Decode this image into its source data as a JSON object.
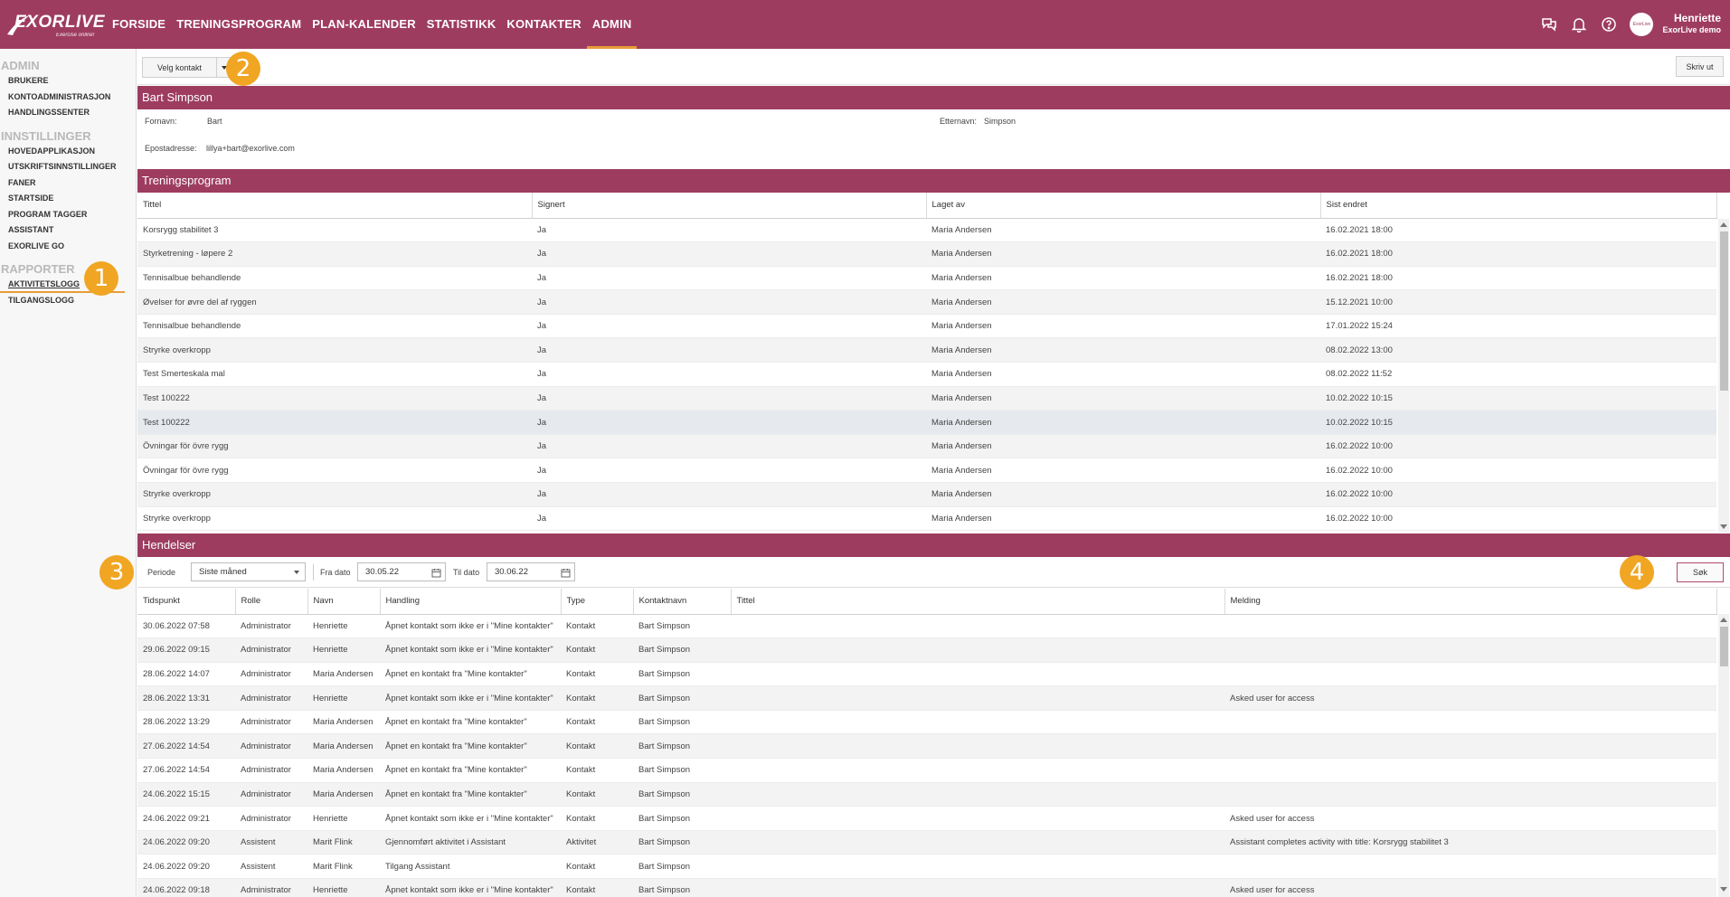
{
  "brand": {
    "name": "EXORLIVE",
    "tagline": "Exercise online!"
  },
  "nav": {
    "items": [
      "FORSIDE",
      "TRENINGSPROGRAM",
      "PLAN-KALENDER",
      "STATISTIKK",
      "KONTAKTER",
      "ADMIN"
    ],
    "active": "ADMIN"
  },
  "user": {
    "name": "Henriette",
    "org": "ExorLive demo",
    "avatar_text": "ExorLive"
  },
  "sidebar": {
    "admin_head": "ADMIN",
    "admin_items": [
      "BRUKERE",
      "KONTOADMINISTRASJON",
      "HANDLINGSSENTER"
    ],
    "settings_head": "INNSTILLINGER",
    "settings_items": [
      "HOVEDAPPLIKASJON",
      "UTSKRIFTSINNSTILLINGER",
      "FANER",
      "STARTSIDE",
      "PROGRAM TAGGER",
      "ASSISTANT",
      "EXORLIVE GO"
    ],
    "reports_head": "RAPPORTER",
    "reports_items": [
      "AKTIVITETSLOGG",
      "TILGANGSLOGG"
    ]
  },
  "badges": [
    "1",
    "2",
    "3",
    "4"
  ],
  "toolbar": {
    "select_contact": "Velg kontakt",
    "print": "Skriv ut"
  },
  "contact": {
    "header": "Bart Simpson",
    "firstname_label": "Fornavn:",
    "firstname": "Bart",
    "lastname_label": "Etternavn:",
    "lastname": "Simpson",
    "email_label": "Epostadresse:",
    "email": "lillya+bart@exorlive.com"
  },
  "programs": {
    "header": "Treningsprogram",
    "columns": [
      "Tittel",
      "Signert",
      "Laget av",
      "Sist endret"
    ],
    "rows": [
      [
        "Korsrygg stabilitet 3",
        "Ja",
        "Maria Andersen",
        "16.02.2021 18:00"
      ],
      [
        "Styrketrening - løpere 2",
        "Ja",
        "Maria Andersen",
        "16.02.2021 18:00"
      ],
      [
        "Tennisalbue behandlende",
        "Ja",
        "Maria Andersen",
        "16.02.2021 18:00"
      ],
      [
        "Øvelser for øvre del af ryggen",
        "Ja",
        "Maria Andersen",
        "15.12.2021 10:00"
      ],
      [
        "Tennisalbue behandlende",
        "Ja",
        "Maria Andersen",
        "17.01.2022 15:24"
      ],
      [
        "Stryrke overkropp",
        "Ja",
        "Maria Andersen",
        "08.02.2022 13:00"
      ],
      [
        "Test Smerteskala mal",
        "Ja",
        "Maria Andersen",
        "08.02.2022 11:52"
      ],
      [
        "Test 100222",
        "Ja",
        "Maria Andersen",
        "10.02.2022 10:15"
      ],
      [
        "Test 100222",
        "Ja",
        "Maria Andersen",
        "10.02.2022 10:15"
      ],
      [
        "Övningar för övre rygg",
        "Ja",
        "Maria Andersen",
        "16.02.2022 10:00"
      ],
      [
        "Övningar för övre rygg",
        "Ja",
        "Maria Andersen",
        "16.02.2022 10:00"
      ],
      [
        "Stryrke overkropp",
        "Ja",
        "Maria Andersen",
        "16.02.2022 10:00"
      ],
      [
        "Stryrke overkropp",
        "Ja",
        "Maria Andersen",
        "16.02.2022 10:00"
      ]
    ]
  },
  "events": {
    "header": "Hendelser",
    "period_label": "Periode",
    "period_value": "Siste måned",
    "from_label": "Fra dato",
    "from_value": "30.05.22",
    "to_label": "Til dato",
    "to_value": "30.06.22",
    "search_button": "Søk",
    "columns": [
      "Tidspunkt",
      "Rolle",
      "Navn",
      "Handling",
      "Type",
      "Kontaktnavn",
      "Tittel",
      "Melding"
    ],
    "rows": [
      [
        "30.06.2022 07:58",
        "Administrator",
        "Henriette",
        "Åpnet kontakt som ikke er i \"Mine kontakter\"",
        "Kontakt",
        "Bart Simpson",
        "",
        ""
      ],
      [
        "29.06.2022 09:15",
        "Administrator",
        "Henriette",
        "Åpnet kontakt som ikke er i \"Mine kontakter\"",
        "Kontakt",
        "Bart Simpson",
        "",
        ""
      ],
      [
        "28.06.2022 14:07",
        "Administrator",
        "Maria Andersen",
        "Åpnet en kontakt fra \"Mine kontakter\"",
        "Kontakt",
        "Bart Simpson",
        "",
        ""
      ],
      [
        "28.06.2022 13:31",
        "Administrator",
        "Henriette",
        "Åpnet kontakt som ikke er i \"Mine kontakter\"",
        "Kontakt",
        "Bart Simpson",
        "",
        "Asked user for access"
      ],
      [
        "28.06.2022 13:29",
        "Administrator",
        "Maria Andersen",
        "Åpnet en kontakt fra \"Mine kontakter\"",
        "Kontakt",
        "Bart Simpson",
        "",
        ""
      ],
      [
        "27.06.2022 14:54",
        "Administrator",
        "Maria Andersen",
        "Åpnet en kontakt fra \"Mine kontakter\"",
        "Kontakt",
        "Bart Simpson",
        "",
        ""
      ],
      [
        "27.06.2022 14:54",
        "Administrator",
        "Maria Andersen",
        "Åpnet en kontakt fra \"Mine kontakter\"",
        "Kontakt",
        "Bart Simpson",
        "",
        ""
      ],
      [
        "24.06.2022 15:15",
        "Administrator",
        "Maria Andersen",
        "Åpnet en kontakt fra \"Mine kontakter\"",
        "Kontakt",
        "Bart Simpson",
        "",
        ""
      ],
      [
        "24.06.2022 09:21",
        "Administrator",
        "Henriette",
        "Åpnet kontakt som ikke er i \"Mine kontakter\"",
        "Kontakt",
        "Bart Simpson",
        "",
        "Asked user for access"
      ],
      [
        "24.06.2022 09:20",
        "Assistent",
        "Marit Flink",
        "Gjennomført aktivitet i Assistant",
        "Aktivitet",
        "Bart Simpson",
        "",
        "Assistant completes activity with title: Korsrygg stabilitet 3"
      ],
      [
        "24.06.2022 09:20",
        "Assistent",
        "Marit Flink",
        "Tilgang Assistant",
        "Kontakt",
        "Bart Simpson",
        "",
        ""
      ],
      [
        "24.06.2022 09:18",
        "Administrator",
        "Henriette",
        "Åpnet kontakt som ikke er i \"Mine kontakter\"",
        "Kontakt",
        "Bart Simpson",
        "",
        "Asked user for access"
      ]
    ]
  },
  "colors": {
    "brand": "#9e3c60",
    "accent": "#e99c3b",
    "badge": "#f0a623"
  }
}
